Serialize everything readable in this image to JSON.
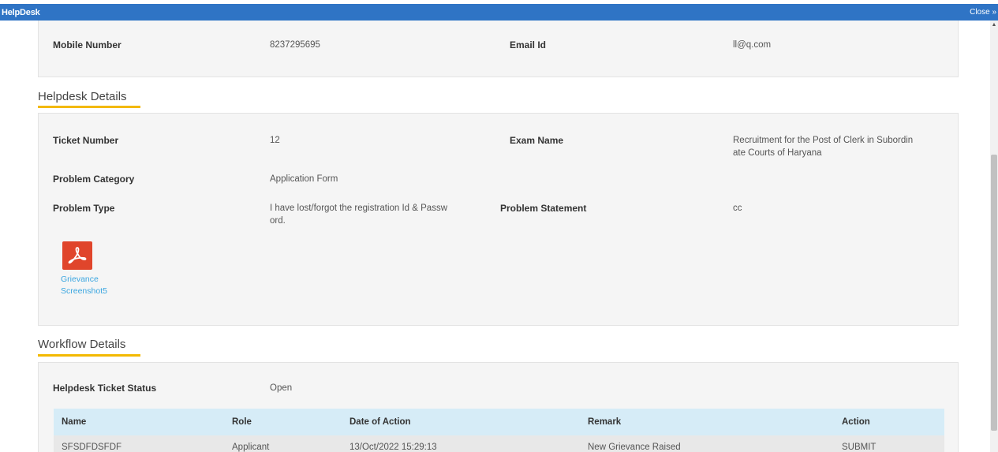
{
  "window": {
    "title": "HelpDesk",
    "close_label": "Close »"
  },
  "contact": {
    "mobile_label": "Mobile Number",
    "mobile_value": "8237295695",
    "email_label": "Email Id",
    "email_value": "ll@q.com"
  },
  "helpdesk": {
    "heading": "Helpdesk Details",
    "ticket_label": "Ticket Number",
    "ticket_value": "12",
    "exam_label": "Exam Name",
    "exam_value_line1": "Recruitment for the Post of Clerk in Subordin",
    "exam_value_line2": "ate Courts of Haryana",
    "category_label": "Problem Category",
    "category_value": "Application Form",
    "type_label": "Problem Type",
    "type_value_line1": "I have lost/forgot the registration Id & Passw",
    "type_value_line2": "ord.",
    "statement_label": "Problem Statement",
    "statement_value": "cc",
    "attachment_line1": "Grievance",
    "attachment_line2": "Screenshot5",
    "attachment_icon": "pdf-icon"
  },
  "workflow": {
    "heading": "Workflow Details",
    "status_label": "Helpdesk Ticket Status",
    "status_value": "Open",
    "columns": [
      "Name",
      "Role",
      "Date of Action",
      "Remark",
      "Action"
    ],
    "rows": [
      [
        "SFSDFDSFDF",
        "Applicant",
        "13/Oct/2022 15:29:13",
        "New Grievance Raised",
        "SUBMIT"
      ]
    ]
  },
  "colors": {
    "titlebar": "#2f74c5",
    "accent_underline": "#f3b900",
    "table_header": "#d6ecf7",
    "link": "#3aa6e0",
    "pdf": "#e0452b"
  }
}
